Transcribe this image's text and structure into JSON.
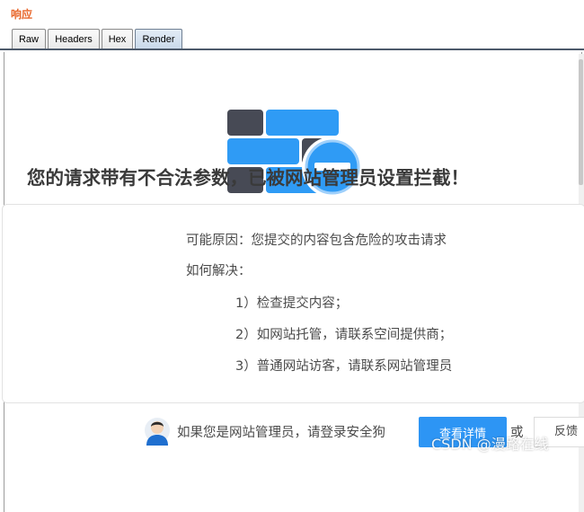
{
  "section_title": "响应",
  "tabs": [
    {
      "label": "Raw"
    },
    {
      "label": "Headers"
    },
    {
      "label": "Hex"
    },
    {
      "label": "Render",
      "active": true
    }
  ],
  "page": {
    "heading": "您的请求带有不合法参数，已被网站管理员设置拦截！",
    "reason": "可能原因：您提交的内容包含危险的攻击请求",
    "solution_title": "如何解决：",
    "steps": [
      "1）检查提交内容；",
      "2）如网站托管，请联系空间提供商；",
      "3）普通网站访客，请联系网站管理员"
    ],
    "admin_prompt": "如果您是网站管理员，请登录安全狗",
    "detail_button": "查看详情",
    "or_text": "或",
    "feedback_button": "反馈"
  },
  "watermark": "CSDN @漫路在线",
  "colors": {
    "accent_blue": "#2d95f4",
    "brick_blue": "#2f9bf5",
    "brick_dark": "#474a55",
    "title_orange": "#e8662a"
  },
  "icons": {
    "logo": "firewall-block-icon",
    "avatar": "admin-avatar-icon"
  }
}
